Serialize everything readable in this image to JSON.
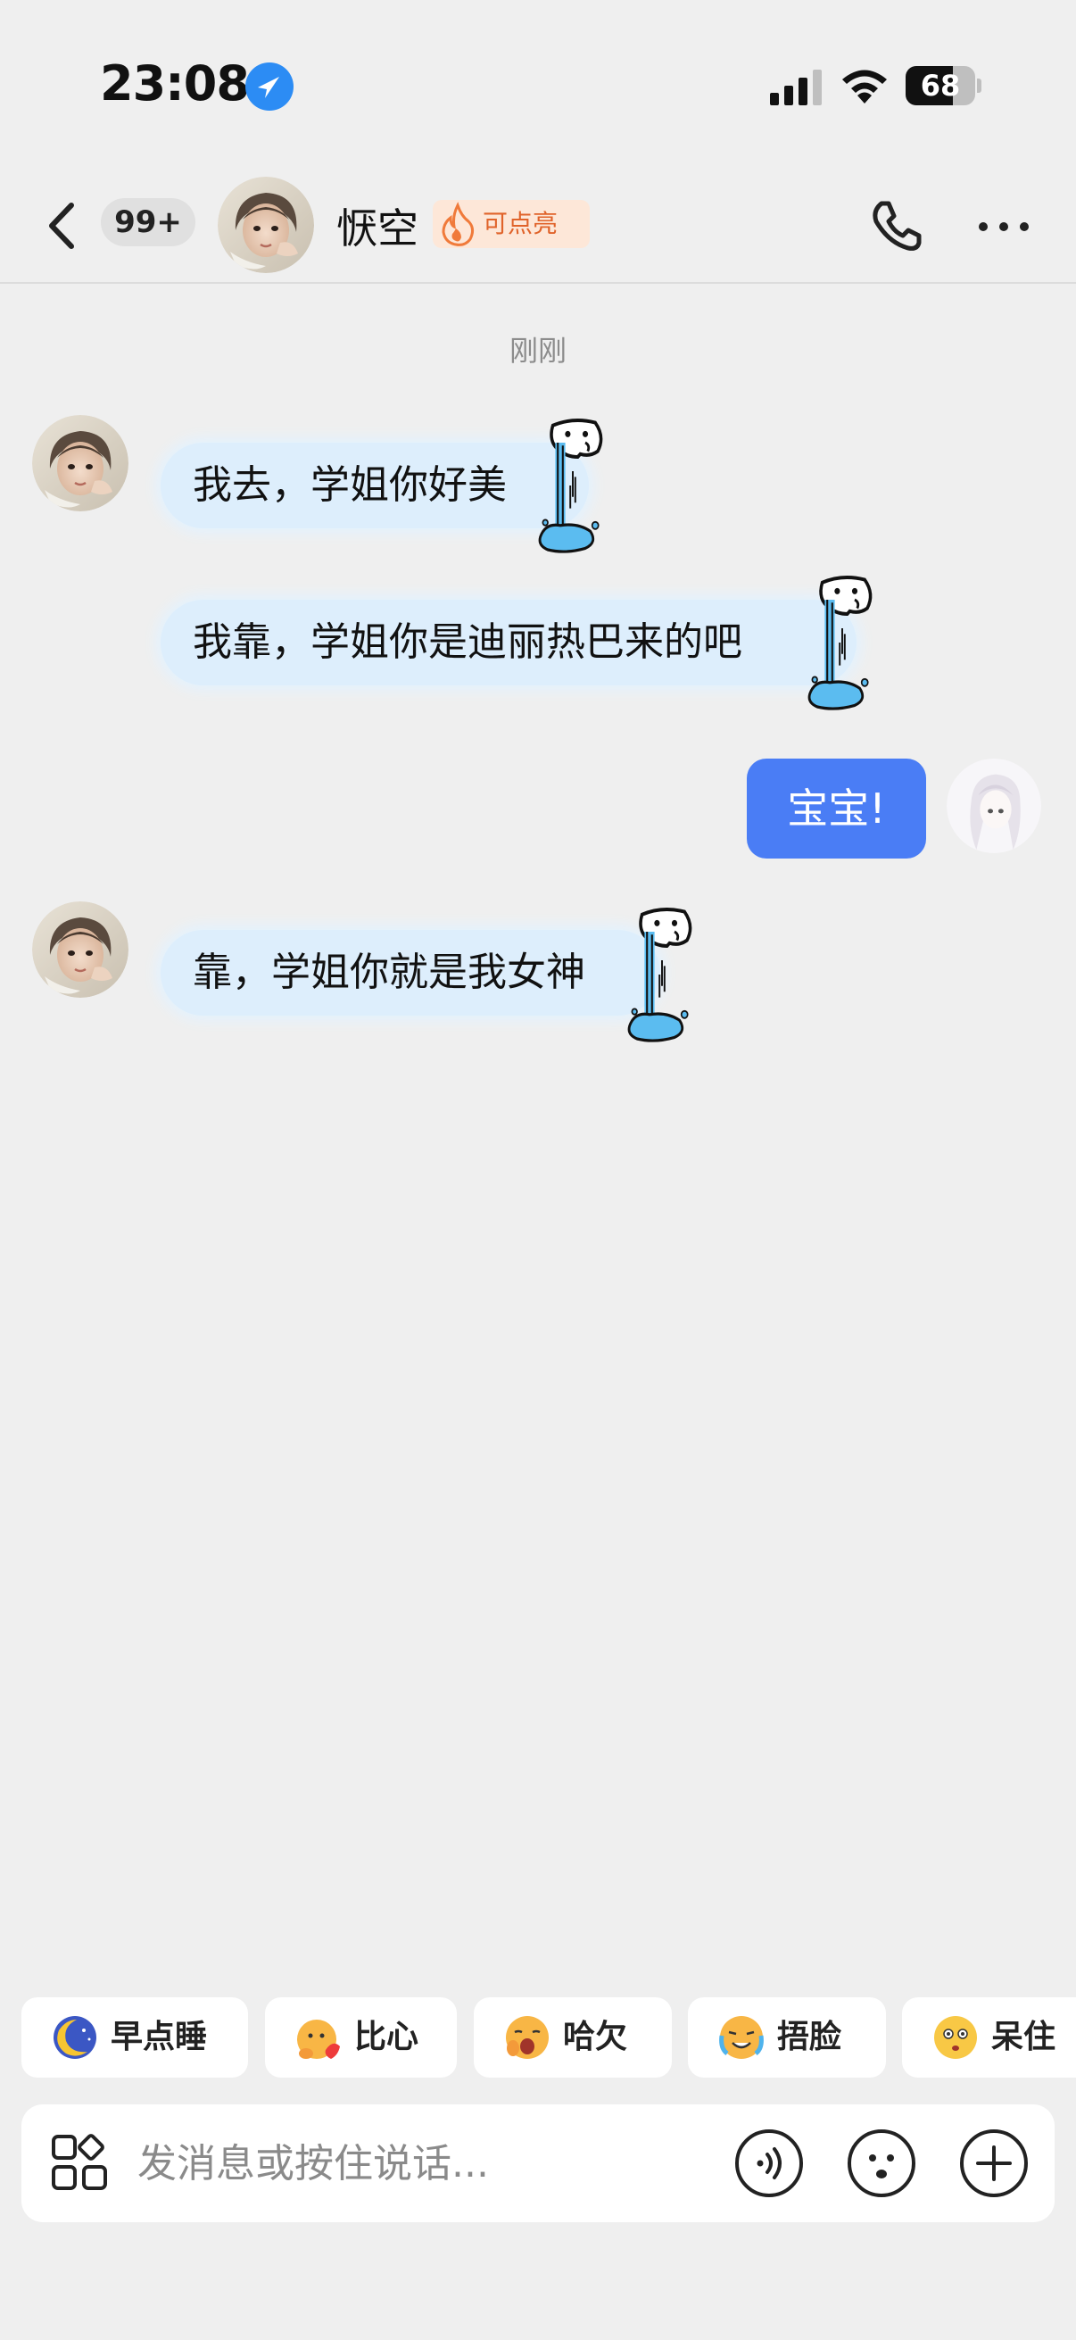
{
  "status_bar": {
    "time": "23:08",
    "battery": "68",
    "battery_level": 0.68
  },
  "header": {
    "unread_count": "99+",
    "contact_name": "恹空",
    "spark_label": "可点亮"
  },
  "chat": {
    "timestamp": "刚刚",
    "messages": [
      {
        "side": "in",
        "text": "我去，学姐你好美"
      },
      {
        "side": "in",
        "text": "我靠，学姐你是迪丽热巴来的吧"
      },
      {
        "side": "out",
        "text": "宝宝!"
      },
      {
        "side": "in",
        "text": "靠，学姐你就是我女神"
      }
    ]
  },
  "quick_replies": [
    {
      "label": "早点睡",
      "icon": "moon-emoji-icon"
    },
    {
      "label": "比心",
      "icon": "heart-hands-emoji-icon"
    },
    {
      "label": "哈欠",
      "icon": "yawn-emoji-icon"
    },
    {
      "label": "捂脸",
      "icon": "facepalm-emoji-icon"
    },
    {
      "label": "呆住",
      "icon": "stunned-emoji-icon"
    }
  ],
  "input": {
    "placeholder": "发消息或按住说话..."
  },
  "colors": {
    "background": "#efefef",
    "incoming_bubble": "#ddeefc",
    "outgoing_bubble": "#4a7df5",
    "spark_text": "#e0632a",
    "waterfall_blue": "#5bbcf0"
  }
}
